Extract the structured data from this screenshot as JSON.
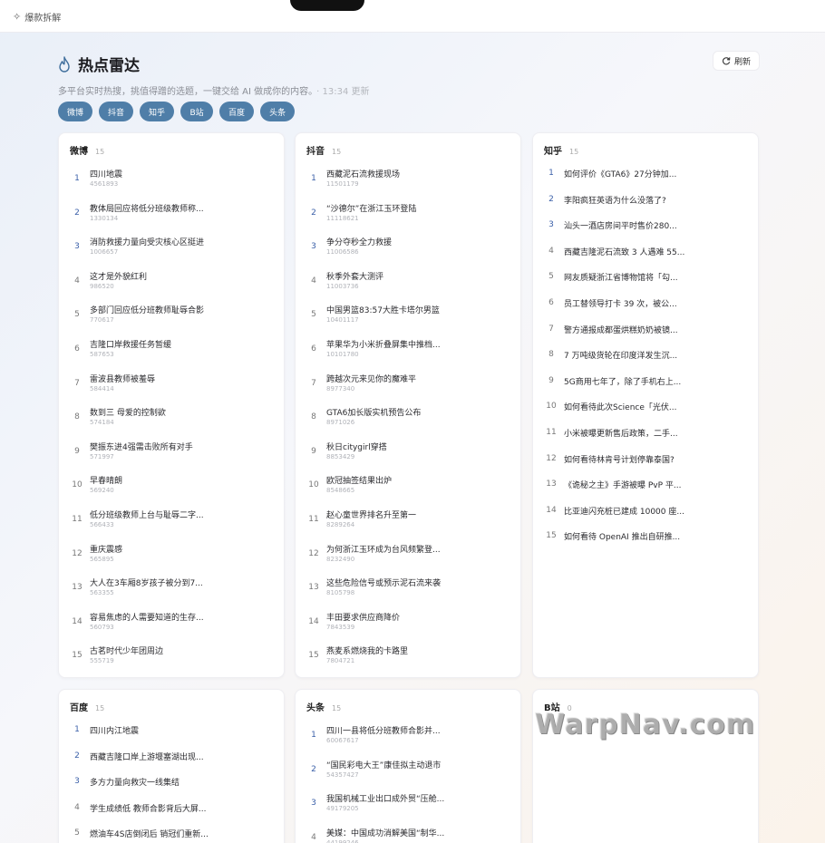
{
  "topbar": {
    "brand_icon": "sparkle-icon",
    "brand": "爆款拆解"
  },
  "header": {
    "title": "热点雷达",
    "subtitle": "多平台实时热搜，挑值得蹭的选题，一键交给 AI 做成你的内容。",
    "updated": "· 13:34 更新",
    "refresh": "刷新"
  },
  "chips": [
    "微博",
    "抖音",
    "知乎",
    "B站",
    "百度",
    "头条"
  ],
  "accent": "#4f7ea8",
  "cards": [
    {
      "name": "微博",
      "count": "15",
      "items": [
        {
          "rank": "1",
          "title": "四川地震",
          "heat": "4561893"
        },
        {
          "rank": "2",
          "title": "教体局回应将低分班级教师称...",
          "heat": "1330134"
        },
        {
          "rank": "3",
          "title": "消防救援力量向受灾核心区挺进",
          "heat": "1006657"
        },
        {
          "rank": "4",
          "title": "这才是外貌红利",
          "heat": "986520"
        },
        {
          "rank": "5",
          "title": "多部门回应低分班教师耻辱合影",
          "heat": "770617"
        },
        {
          "rank": "6",
          "title": "吉隆口岸救援任务暂缓",
          "heat": "587653"
        },
        {
          "rank": "7",
          "title": "雷波县教师被羞辱",
          "heat": "584414"
        },
        {
          "rank": "8",
          "title": "数到三 母爱的控制欲",
          "heat": "574184"
        },
        {
          "rank": "9",
          "title": "樊振东进4强需击败所有对手",
          "heat": "571997"
        },
        {
          "rank": "10",
          "title": "早春晴朗",
          "heat": "569240"
        },
        {
          "rank": "11",
          "title": "低分班级教师上台与耻辱二字...",
          "heat": "566433"
        },
        {
          "rank": "12",
          "title": "重庆震感",
          "heat": "565895"
        },
        {
          "rank": "13",
          "title": "大人在3车厢8岁孩子被分到7...",
          "heat": "563355"
        },
        {
          "rank": "14",
          "title": "容易焦虑的人需要知道的生存...",
          "heat": "560793"
        },
        {
          "rank": "15",
          "title": "古茗时代少年团周边",
          "heat": "555719"
        }
      ]
    },
    {
      "name": "抖音",
      "count": "15",
      "items": [
        {
          "rank": "1",
          "title": "西藏泥石流救援现场",
          "heat": "11501179"
        },
        {
          "rank": "2",
          "title": "“沙德尔”在浙江玉环登陆",
          "heat": "11118621"
        },
        {
          "rank": "3",
          "title": "争分夺秒全力救援",
          "heat": "11006586"
        },
        {
          "rank": "4",
          "title": "秋季外套大测评",
          "heat": "11003736"
        },
        {
          "rank": "5",
          "title": "中国男篮83:57大胜卡塔尔男篮",
          "heat": "10401117"
        },
        {
          "rank": "6",
          "title": "苹果华为小米折叠屏集中推档...",
          "heat": "10101780"
        },
        {
          "rank": "7",
          "title": "跨越次元来见你的魔难平",
          "heat": "8977340"
        },
        {
          "rank": "8",
          "title": "GTA6加长版实机预告公布",
          "heat": "8971026"
        },
        {
          "rank": "9",
          "title": "秋日citygirl穿搭",
          "heat": "8853429"
        },
        {
          "rank": "10",
          "title": "欧冠抽签结果出炉",
          "heat": "8548665"
        },
        {
          "rank": "11",
          "title": "赵心童世界排名升至第一",
          "heat": "8289264"
        },
        {
          "rank": "12",
          "title": "为何浙江玉环成为台风频繁登...",
          "heat": "8232490"
        },
        {
          "rank": "13",
          "title": "这些危险信号或预示泥石流来袭",
          "heat": "8105798"
        },
        {
          "rank": "14",
          "title": "丰田要求供应商降价",
          "heat": "7843539"
        },
        {
          "rank": "15",
          "title": "燕麦系燃烧我的卡路里",
          "heat": "7804721"
        }
      ]
    },
    {
      "name": "知乎",
      "count": "15",
      "items": [
        {
          "rank": "1",
          "title": "如何评价《GTA6》27分钟加..."
        },
        {
          "rank": "2",
          "title": "李阳疯狂英语为什么没落了?"
        },
        {
          "rank": "3",
          "title": "汕头一酒店房间平时售价280..."
        },
        {
          "rank": "4",
          "title": "西藏吉隆泥石流致 3 人遇难 55..."
        },
        {
          "rank": "5",
          "title": "网友质疑浙江省博物馆将「勾..."
        },
        {
          "rank": "6",
          "title": "员工替领导打卡 39 次，被公..."
        },
        {
          "rank": "7",
          "title": "警方通报成都蛋烘糕奶奶被镜..."
        },
        {
          "rank": "8",
          "title": "7 万吨级货轮在印度洋发生沉..."
        },
        {
          "rank": "9",
          "title": "5G商用七年了，除了手机右上..."
        },
        {
          "rank": "10",
          "title": "如何看待此次Science「光伏..."
        },
        {
          "rank": "11",
          "title": "小米被曝更新售后政策，二手..."
        },
        {
          "rank": "12",
          "title": "如何看待林肯号计划停靠泰国?"
        },
        {
          "rank": "13",
          "title": "《诡秘之主》手游被曝 PvP 平..."
        },
        {
          "rank": "14",
          "title": "比亚迪闪充桩已建成 10000 座..."
        },
        {
          "rank": "15",
          "title": "如何看待 OpenAI 推出自研推..."
        }
      ]
    },
    {
      "name": "百度",
      "count": "15",
      "items": [
        {
          "rank": "1",
          "title": "四川内江地震"
        },
        {
          "rank": "2",
          "title": "西藏吉隆口岸上游堰塞湖出现..."
        },
        {
          "rank": "3",
          "title": "多方力量向救灾一线集结"
        },
        {
          "rank": "4",
          "title": "学生成绩低 教师合影背后大屏..."
        },
        {
          "rank": "5",
          "title": "燃油车4S店倒闭后 销冠们重新..."
        }
      ]
    },
    {
      "name": "头条",
      "count": "15",
      "items": [
        {
          "rank": "1",
          "title": "四川一县将低分班教师合影并...",
          "heat": "60067617"
        },
        {
          "rank": "2",
          "title": "“国民彩电大王”康佳拟主动退市",
          "heat": "54357427"
        },
        {
          "rank": "3",
          "title": "我国机械工业出口成外贸“压舱...",
          "heat": "49179205"
        },
        {
          "rank": "4",
          "title": "美媒：中国成功消解美国“制华...",
          "heat": "44199246"
        }
      ]
    },
    {
      "name": "B站",
      "count": "0",
      "items": []
    }
  ],
  "watermark": "WarpNav.com"
}
